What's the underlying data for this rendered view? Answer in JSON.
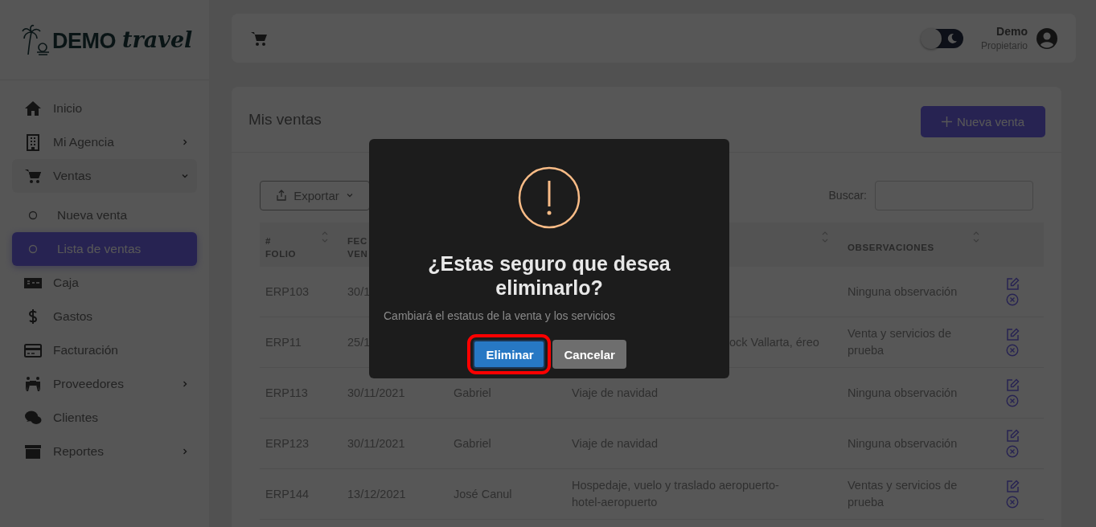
{
  "logo": {
    "brand": "DEMO",
    "script": "travel"
  },
  "sidebar": {
    "items": [
      {
        "label": "Inicio",
        "selected": false
      },
      {
        "label": "Mi Agencia",
        "selected": false,
        "expanded": false
      },
      {
        "label": "Ventas",
        "selected": false,
        "expanded": true,
        "children": [
          {
            "label": "Nueva venta",
            "selected": false
          },
          {
            "label": "Lista de ventas",
            "selected": true
          }
        ]
      },
      {
        "label": "Caja",
        "selected": false
      },
      {
        "label": "Gastos",
        "selected": false
      },
      {
        "label": "Facturación",
        "selected": false
      },
      {
        "label": "Proveedores",
        "selected": false,
        "expanded": false
      },
      {
        "label": "Clientes",
        "selected": false
      },
      {
        "label": "Reportes",
        "selected": false,
        "expanded": false
      }
    ]
  },
  "topbar": {
    "dark_mode": false,
    "user": {
      "name": "Demo",
      "role": "Propietario"
    }
  },
  "page": {
    "title": "Mis ventas",
    "new_button": "Nueva venta"
  },
  "toolbar": {
    "export": "Exportar",
    "search_label": "Buscar:"
  },
  "table": {
    "columns": [
      {
        "label": "# FOLIO",
        "sortable": true
      },
      {
        "label": "FEC VEN"
      },
      {},
      {
        "sortable": true
      },
      {
        "label": "OBSERVACIONES",
        "sortable": true
      },
      {}
    ],
    "rows": [
      {
        "folio": "ERP103",
        "date": "30/1",
        "observations": "Ninguna observación"
      },
      {
        "folio": "ERP11",
        "date": "25/1",
        "description": "ock Vallarta, éreo",
        "observations": "Venta y servicios de prueba"
      },
      {
        "folio": "ERP113",
        "date": "30/11/2021",
        "client": "Gabriel",
        "description": "Viaje de navidad",
        "observations": "Ninguna observación"
      },
      {
        "folio": "ERP123",
        "date": "30/11/2021",
        "client": "Gabriel",
        "description": "Viaje de navidad",
        "observations": "Ninguna observación"
      },
      {
        "folio": "ERP144",
        "date": "13/12/2021",
        "client": "José Canul",
        "description": "Hospedaje, vuelo y traslado aeropuerto-hotel-aeropuerto",
        "observations": "Ventas y servicios de prueba"
      }
    ]
  },
  "dialog": {
    "title": "¿Estas seguro que desea eliminarlo?",
    "message": "Cambiará el estatus de la venta y los servicios",
    "buttons": [
      {
        "label": "Eliminar",
        "kind": "confirm",
        "highlighted": true
      },
      {
        "label": "Cancelar",
        "kind": "cancel",
        "highlighted": false
      }
    ]
  }
}
